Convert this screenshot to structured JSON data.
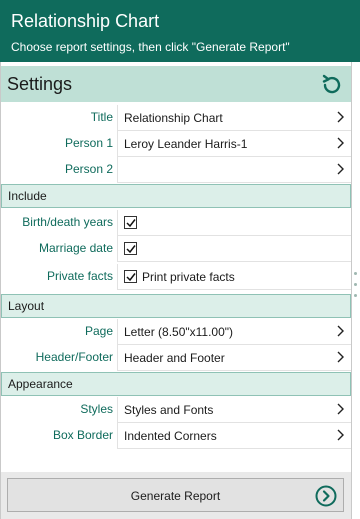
{
  "header": {
    "title": "Relationship Chart",
    "subtitle": "Choose report settings, then click \"Generate Report\""
  },
  "settings": {
    "heading": "Settings",
    "reset_icon": "reset-icon"
  },
  "general": [
    {
      "label": "Title",
      "value": "Relationship Chart"
    },
    {
      "label": "Person 1",
      "value": "Leroy Leander Harris-1"
    },
    {
      "label": "Person 2",
      "value": ""
    }
  ],
  "include": {
    "heading": "Include",
    "birth_death": {
      "label": "Birth/death years",
      "checked": true
    },
    "marriage": {
      "label": "Marriage date",
      "checked": true
    },
    "private": {
      "label": "Private facts",
      "checked": true,
      "text": "Print private facts"
    }
  },
  "layout": {
    "heading": "Layout",
    "page": {
      "label": "Page",
      "value": "Letter (8.50\"x11.00\")"
    },
    "header_footer": {
      "label": "Header/Footer",
      "value": "Header and Footer"
    }
  },
  "appearance": {
    "heading": "Appearance",
    "styles": {
      "label": "Styles",
      "value": "Styles and Fonts"
    },
    "box_border": {
      "label": "Box Border",
      "value": "Indented Corners"
    }
  },
  "footer": {
    "generate_label": "Generate Report"
  },
  "colors": {
    "accent": "#0f6b5c",
    "section_bg": "#dcefe9",
    "settings_bg": "#bfe0d6"
  }
}
